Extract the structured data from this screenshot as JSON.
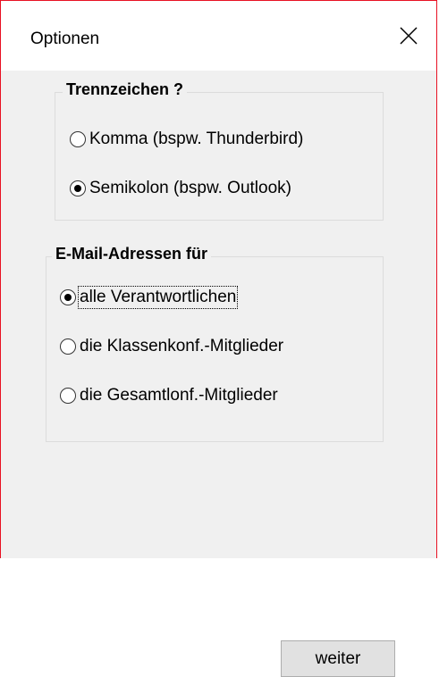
{
  "window": {
    "title": "Optionen",
    "close_icon": "close-icon",
    "accent_border": "#e81123"
  },
  "separator_group": {
    "legend": "Trennzeichen ?",
    "options": [
      {
        "label": "Komma (bspw. Thunderbird)",
        "checked": false
      },
      {
        "label": "Semikolon (bspw. Outlook)",
        "checked": true
      }
    ]
  },
  "email_group": {
    "legend": "E-Mail-Adressen für",
    "options": [
      {
        "label": "alle Verantwortlichen",
        "checked": true,
        "focused": true
      },
      {
        "label": "die Klassenkonf.-Mitglieder",
        "checked": false
      },
      {
        "label": "die Gesamtlonf.-Mitglieder",
        "checked": false
      }
    ]
  },
  "footer": {
    "next_label": "weiter"
  }
}
